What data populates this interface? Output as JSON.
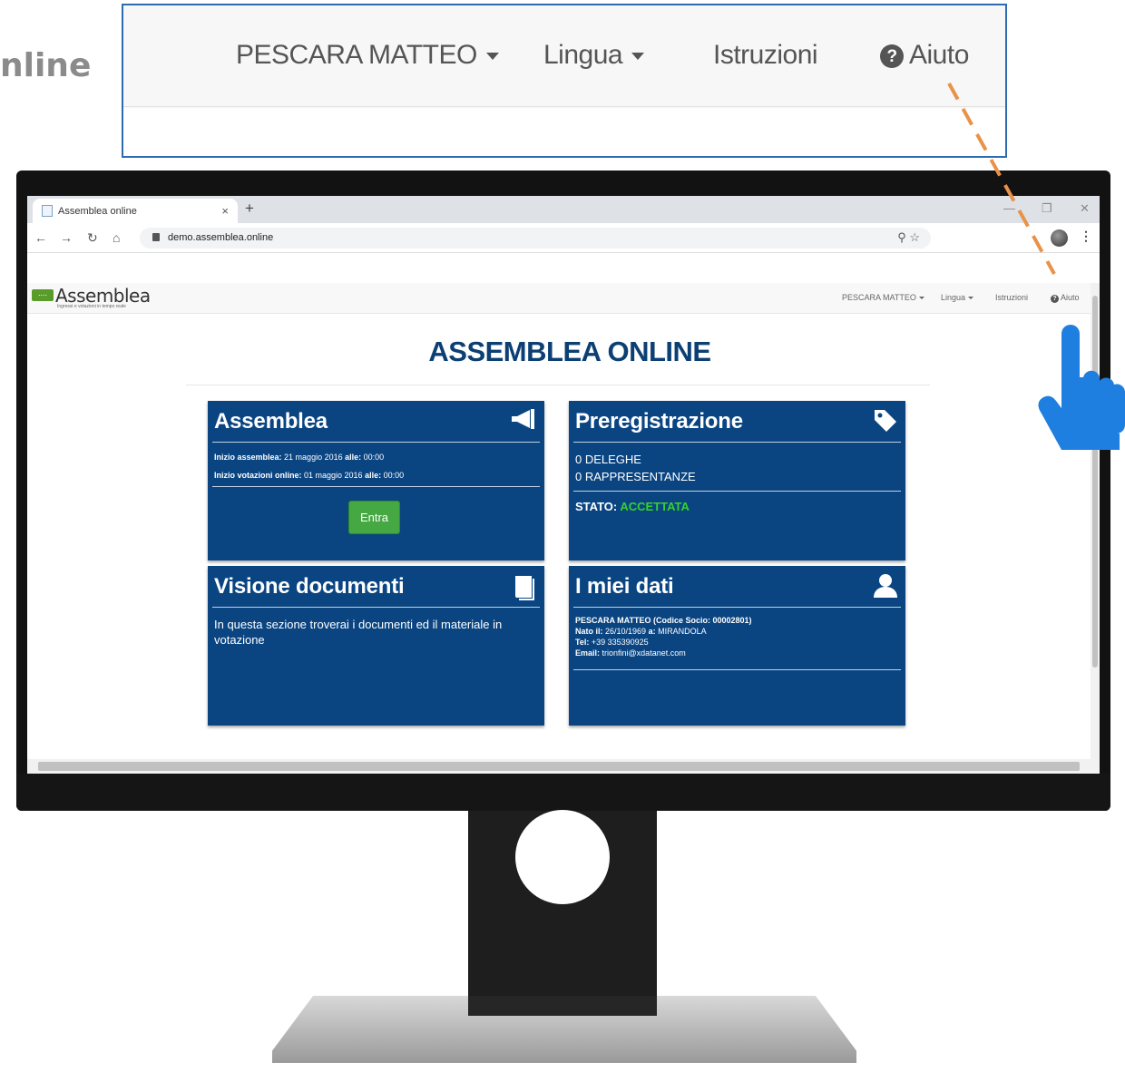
{
  "background_title": "nline",
  "zoom_nav": {
    "user": "PESCARA MATTEO",
    "lingua": "Lingua",
    "istruzioni": "Istruzioni",
    "aiuto": "Aiuto"
  },
  "browser": {
    "tab_title": "Assemblea online",
    "tab_close": "×",
    "new_tab": "+",
    "url": "demo.assemblea.online"
  },
  "site": {
    "logo_text": "Assemblea",
    "logo_subtitle": "Ingressi e votazioni in tempo reale",
    "nav": {
      "user": "PESCARA MATTEO",
      "lingua": "Lingua",
      "istruzioni": "Istruzioni",
      "aiuto": "Aiuto"
    },
    "page_title": "ASSEMBLEA ONLINE"
  },
  "cards": {
    "assemblea": {
      "title": "Assemblea",
      "inizio_label": "Inizio assemblea:",
      "inizio_date": "21 maggio 2016",
      "alle_label": "alle:",
      "inizio_time": "00:00",
      "votazioni_label": "Inizio votazioni online:",
      "votazioni_date": "01 maggio 2016",
      "votazioni_time": "00:00",
      "button": "Entra",
      "icon": "megaphone-icon"
    },
    "preregistrazione": {
      "title": "Preregistrazione",
      "deleghe": "0 DELEGHE",
      "rappresentanze": "0 RAPPRESENTANZE",
      "stato_label": "STATO:",
      "stato_value": "ACCETTATA",
      "stato_color": "#36d12f",
      "icon": "tag-icon"
    },
    "documenti": {
      "title": "Visione documenti",
      "text": "In questa sezione troverai i documenti ed il materiale in votazione",
      "icon": "book-icon"
    },
    "dati": {
      "title": "I miei dati",
      "name_line": "PESCARA MATTEO (Codice Socio: 00002801)",
      "nato_label": "Nato il:",
      "nato_value": "26/10/1969",
      "a_label": "a:",
      "a_value": "MIRANDOLA",
      "tel_label": "Tel:",
      "tel_value": "+39 335390925",
      "email_label": "Email:",
      "email_value": "trionfini@xdatanet.com",
      "icon": "user-icon"
    }
  },
  "colors": {
    "card_bg": "#0a4582",
    "title": "#0c3f73",
    "button": "#46a843",
    "callout_border": "#2d6cb0",
    "dash": "#e8924a",
    "hand": "#1e7fe0"
  }
}
